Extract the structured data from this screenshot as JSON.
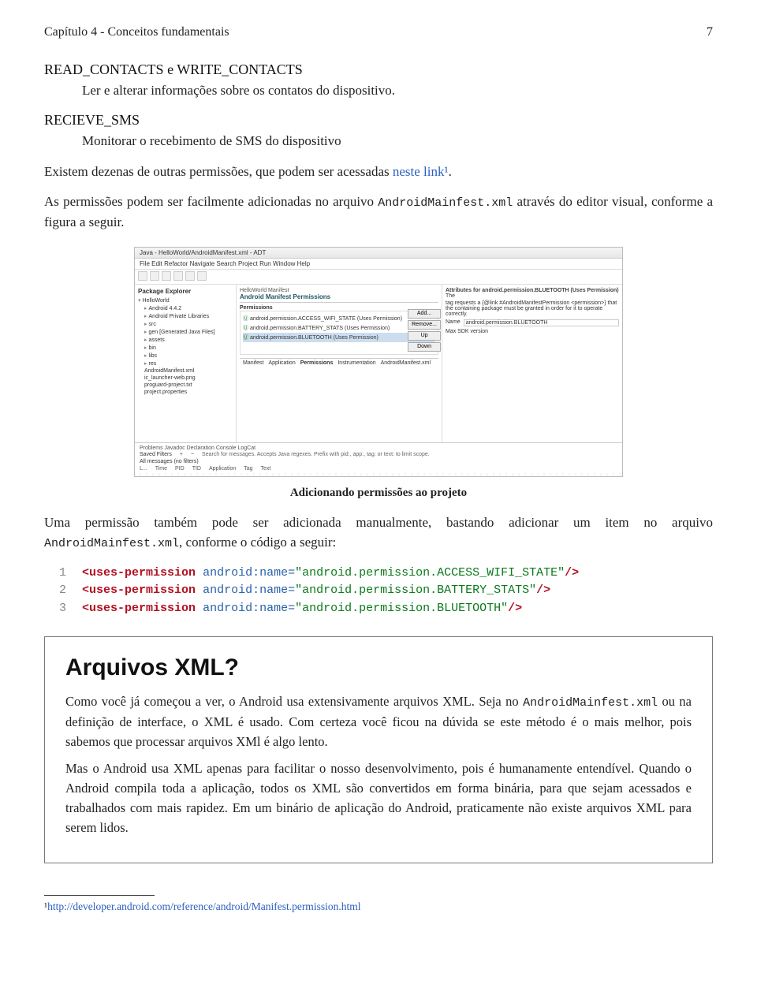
{
  "header": {
    "left": "Capítulo 4 - Conceitos fundamentais",
    "page": "7"
  },
  "terms": [
    {
      "name": "READ_CONTACTS e WRITE_CONTACTS",
      "desc": "Ler e alterar informações sobre os contatos do dispositivo."
    },
    {
      "name": "RECIEVE_SMS",
      "desc": "Monitorar o recebimento de SMS do dispositivo"
    }
  ],
  "para1": {
    "pre": "Existem dezenas de outras permissões, que podem ser acessadas ",
    "link": "neste link¹",
    "post": "."
  },
  "para2": {
    "pre": "As permissões podem ser facilmente adicionadas no arquivo ",
    "code": "AndroidMainfest.xml",
    "post": " através do editor visual, conforme a figura a seguir."
  },
  "ide": {
    "title": "Java - HelloWorld/AndroidManifest.xml - ADT",
    "menu": "File  Edit  Refactor  Navigate  Search  Project  Run  Window  Help",
    "left_title": "Package Explorer",
    "tree": [
      "HelloWorld",
      "Android 4.4.2",
      "Android Private Libraries",
      "src",
      "gen [Generated Java Files]",
      "assets",
      "bin",
      "libs",
      "res",
      "AndroidManifest.xml",
      "ic_launcher-web.png",
      "proguard-project.txt",
      "project.properties"
    ],
    "main_tab": "HelloWorld Manifest",
    "main_head": "Android Manifest Permissions",
    "perm_label": "Permissions",
    "perm_items": [
      "android.permission.ACCESS_WIFI_STATE (Uses Permission)",
      "android.permission.BATTERY_STATS (Uses Permission)",
      "android.permission.BLUETOOTH (Uses Permission)"
    ],
    "btns": {
      "add": "Add...",
      "remove": "Remove...",
      "up": "Up",
      "down": "Down"
    },
    "attr_title": "Attributes for android.permission.BLUETOOTH (Uses Permission)",
    "attr_the": "The",
    "attr_desc": "tag requests a {@link #AndroidManifestPermission <permission>} that the containing package must be granted in order for it to operate correctly.",
    "attr_name_label": "Name",
    "attr_name_value": "android.permission.BLUETOOTH",
    "attr_sdk": "Max SDK version",
    "tabs": [
      "Manifest",
      "Application",
      "Permissions",
      "Instrumentation",
      "AndroidManifest.xml"
    ],
    "bottom_tabs": "Problems   Javadoc   Declaration   Console   LogCat",
    "saved_filters": "Saved Filters",
    "search_hint": "Search for messages. Accepts Java regexes. Prefix with pid:, app:, tag: or text: to limit scope.",
    "allmsg": "All messages (no filters)",
    "cols": [
      "L...",
      "Time",
      "PID",
      "TID",
      "Application",
      "Tag",
      "Text"
    ]
  },
  "fig_caption": "Adicionando permissões ao projeto",
  "para3": {
    "pre": "Uma permissão também pode ser adicionada manualmente, bastando adicionar um item no arquivo ",
    "code": "AndroidMainfest.xml",
    "post": ", conforme o código a seguir:"
  },
  "code": {
    "lines": [
      {
        "n": "1",
        "tag": "uses-permission",
        "attr": "android:name",
        "val": "\"android.permission.ACCESS_WIFI_STATE\""
      },
      {
        "n": "2",
        "tag": "uses-permission",
        "attr": "android:name",
        "val": "\"android.permission.BATTERY_STATS\""
      },
      {
        "n": "3",
        "tag": "uses-permission",
        "attr": "android:name",
        "val": "\"android.permission.BLUETOOTH\""
      }
    ]
  },
  "box": {
    "title": "Arquivos XML?",
    "p1a": "Como você já começou a ver, o Android usa extensivamente arquivos XML. Seja no ",
    "p1code": "AndroidMainfest.xml",
    "p1b": " ou na definição de interface, o XML é usado. Com certeza você ficou na dúvida se este método é o mais melhor, pois sabemos que processar arquivos XMl é algo lento.",
    "p2": "Mas o Android usa XML apenas para facilitar o nosso desenvolvimento, pois é humanamente entendível. Quando o Android compila toda a aplicação, todos os XML são convertidos em forma binária, para que sejam acessados e trabalhados com mais rapidez. Em um binário de aplicação do Android, praticamente não existe arquivos XML para serem lidos."
  },
  "footnote": {
    "marker": "¹",
    "url": "http://developer.android.com/reference/android/Manifest.permission.html"
  }
}
